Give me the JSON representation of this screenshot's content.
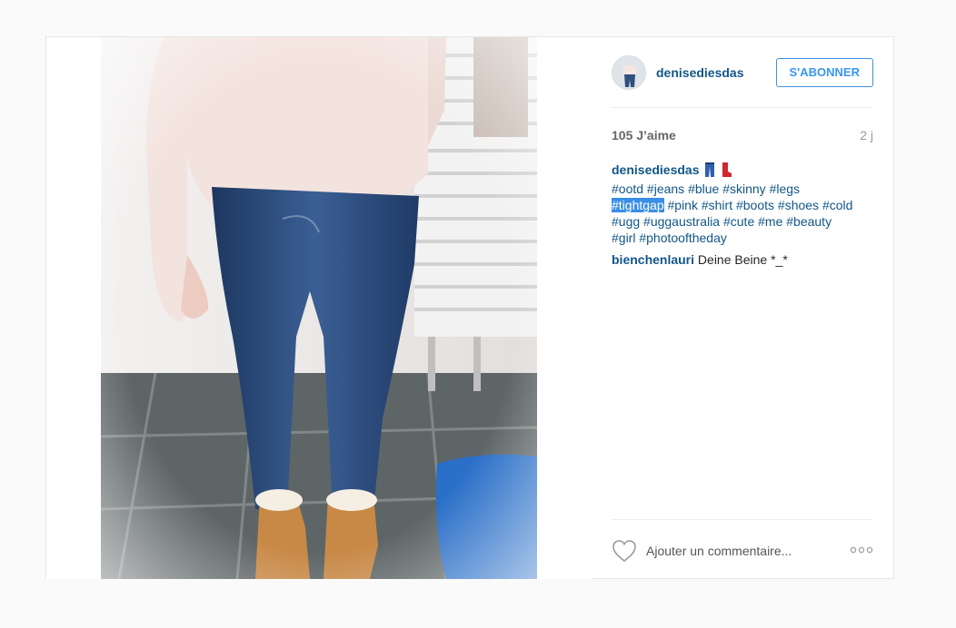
{
  "post": {
    "author": "denisediesdas",
    "follow_label": "S'ABONNER",
    "likes": "105 J’aime",
    "age": "2 j",
    "caption": {
      "user": "denisediesdas",
      "emoji": [
        "jeans-emoji",
        "boot-emoji"
      ],
      "tags_line1": "#ootd #jeans #blue #skinny #legs",
      "tag_selected": "#tightgap",
      "tags_line2_rest": " #pink #shirt #boots #shoes #cold",
      "tags_line3": "#ugg #uggaustralia #cute #me #beauty",
      "tags_line4": "#girl #photooftheday"
    },
    "comment": {
      "user": "bienchenlauri",
      "text": " Deine Beine *_*"
    },
    "add_comment_placeholder": "Ajouter un commentaire...",
    "icons": {
      "like": "heart-icon",
      "more": "more-options-icon"
    },
    "colors": {
      "link": "#125688",
      "follow": "#3897f0",
      "selection": "#3a8ee6"
    }
  }
}
